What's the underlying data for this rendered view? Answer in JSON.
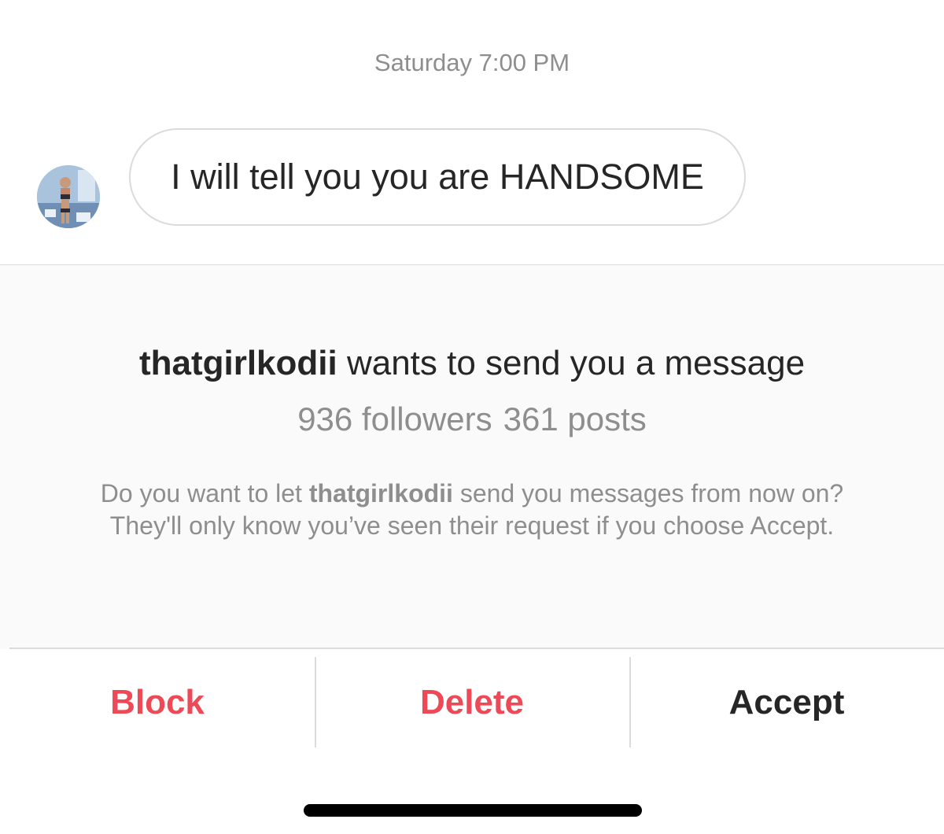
{
  "thread": {
    "timestamp": "Saturday 7:00 PM",
    "message": "I will tell you you are HANDSOME"
  },
  "request": {
    "username": "thatgirlkodii",
    "title_suffix": " wants to send you a message",
    "followers": "936 followers",
    "posts": "361 posts",
    "body_prefix": "Do you want to let ",
    "body_suffix": " send you messages from now on? They'll only know you’ve seen their request if you choose Accept."
  },
  "actions": {
    "block_label": "Block",
    "delete_label": "Delete",
    "accept_label": "Accept"
  },
  "colors": {
    "destructive": "#ed4956",
    "primary_text": "#262626",
    "secondary_text": "#8e8e8e",
    "panel_bg": "#fafafa",
    "border": "#dbdbdb"
  },
  "icons": {
    "avatar": "profile-photo",
    "home_indicator": "home-indicator-bar"
  }
}
